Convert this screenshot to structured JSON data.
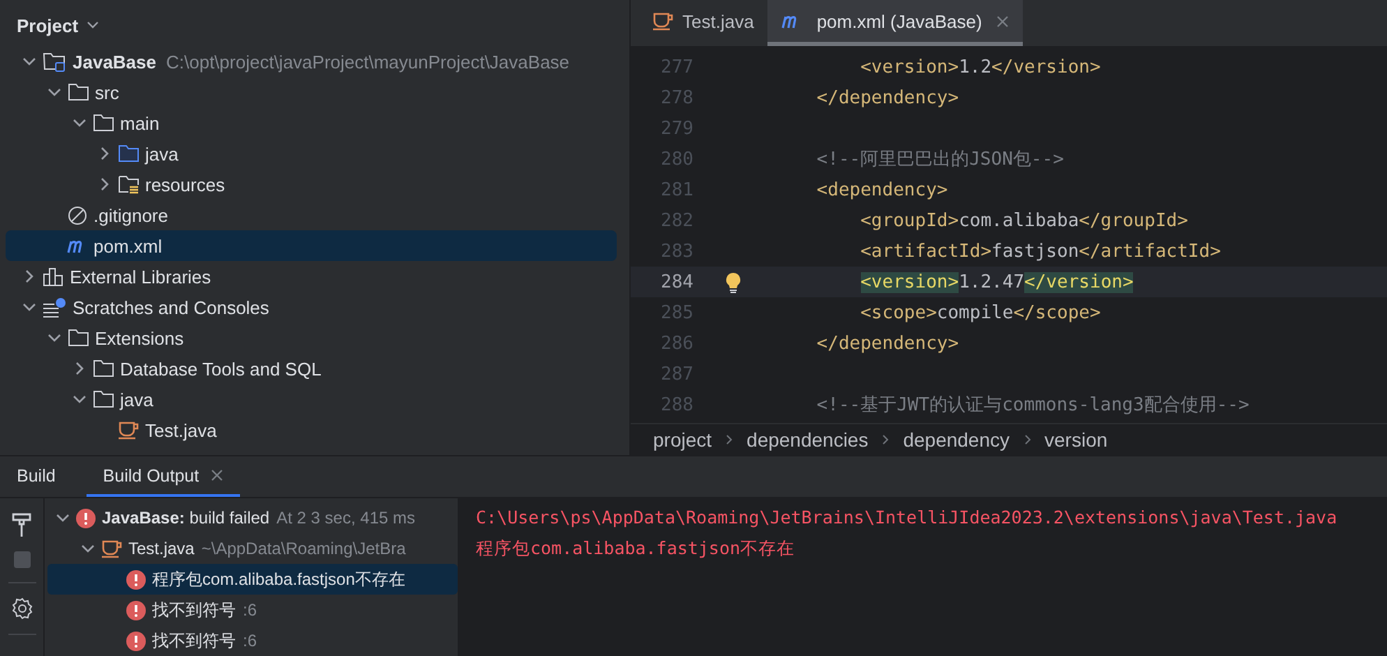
{
  "project_panel": {
    "title": "Project",
    "tree": [
      {
        "label": "JavaBase",
        "hint": "C:\\opt\\project\\javaProject\\mayunProject\\JavaBase",
        "kind": "module",
        "expanded": true,
        "selected": false,
        "bold": true,
        "children": [
          {
            "label": "src",
            "kind": "folder",
            "expanded": true,
            "selected": false,
            "bold": false,
            "children": [
              {
                "label": "main",
                "kind": "folder",
                "expanded": true,
                "selected": false,
                "bold": false,
                "children": [
                  {
                    "label": "java",
                    "kind": "sources",
                    "expanded": false,
                    "selected": false,
                    "bold": false
                  },
                  {
                    "label": "resources",
                    "kind": "resources",
                    "expanded": false,
                    "selected": false,
                    "bold": false
                  }
                ]
              }
            ]
          },
          {
            "label": ".gitignore",
            "kind": "ignore",
            "selected": false,
            "bold": false
          },
          {
            "label": "pom.xml",
            "kind": "maven",
            "selected": true,
            "bold": false
          }
        ]
      },
      {
        "label": "External Libraries",
        "kind": "libraries",
        "expanded": false,
        "selected": false,
        "bold": false
      },
      {
        "label": "Scratches and Consoles",
        "kind": "scratches",
        "expanded": true,
        "selected": false,
        "bold": false,
        "children": [
          {
            "label": "Extensions",
            "kind": "folder",
            "expanded": true,
            "selected": false,
            "bold": false,
            "children": [
              {
                "label": "Database Tools and SQL",
                "kind": "folder",
                "expanded": false,
                "selected": false,
                "bold": false
              },
              {
                "label": "java",
                "kind": "folder",
                "expanded": true,
                "selected": false,
                "bold": false,
                "children": [
                  {
                    "label": "Test.java",
                    "kind": "java",
                    "selected": false,
                    "bold": false
                  }
                ]
              }
            ]
          }
        ]
      }
    ]
  },
  "editor": {
    "tabs": [
      {
        "label": "Test.java",
        "kind": "java",
        "selected": false,
        "closable": false
      },
      {
        "label": "pom.xml (JavaBase)",
        "kind": "maven",
        "selected": true,
        "closable": true
      }
    ],
    "lines": [
      {
        "number": "277",
        "current": false,
        "bulb": false,
        "parts": [
          {
            "kind": "tag",
            "text": "        <version>",
            "matched": false
          },
          {
            "kind": "text",
            "text": "1.2",
            "matched": false
          },
          {
            "kind": "tag",
            "text": "</version>",
            "matched": false
          }
        ]
      },
      {
        "number": "278",
        "current": false,
        "bulb": false,
        "parts": [
          {
            "kind": "tag",
            "text": "    </dependency>",
            "matched": false
          }
        ]
      },
      {
        "number": "279",
        "current": false,
        "bulb": false
      },
      {
        "number": "280",
        "current": false,
        "bulb": false,
        "parts": [
          {
            "kind": "comment",
            "text": "    <!--阿里巴巴出的JSON包-->",
            "matched": false
          }
        ]
      },
      {
        "number": "281",
        "current": false,
        "bulb": false,
        "parts": [
          {
            "kind": "tag",
            "text": "    <dependency>",
            "matched": false
          }
        ]
      },
      {
        "number": "282",
        "current": false,
        "bulb": false,
        "parts": [
          {
            "kind": "tag",
            "text": "        <groupId>",
            "matched": false
          },
          {
            "kind": "text",
            "text": "com.alibaba",
            "matched": false
          },
          {
            "kind": "tag",
            "text": "</groupId>",
            "matched": false
          }
        ]
      },
      {
        "number": "283",
        "current": false,
        "bulb": false,
        "parts": [
          {
            "kind": "tag",
            "text": "        <artifactId>",
            "matched": false
          },
          {
            "kind": "text",
            "text": "fastjson",
            "matched": false
          },
          {
            "kind": "tag",
            "text": "</artifactId>",
            "matched": false
          }
        ]
      },
      {
        "number": "284",
        "current": true,
        "bulb": true,
        "parts": [
          {
            "kind": "tag",
            "text": "        <version>",
            "matched": true
          },
          {
            "kind": "text",
            "text": "1.2.47",
            "matched": false
          },
          {
            "kind": "tag",
            "text": "</version>",
            "matched": true
          }
        ]
      },
      {
        "number": "285",
        "current": false,
        "bulb": false,
        "parts": [
          {
            "kind": "tag",
            "text": "        <scope>",
            "matched": false
          },
          {
            "kind": "text",
            "text": "compile",
            "matched": false
          },
          {
            "kind": "tag",
            "text": "</scope>",
            "matched": false
          }
        ]
      },
      {
        "number": "286",
        "current": false,
        "bulb": false,
        "parts": [
          {
            "kind": "tag",
            "text": "    </dependency>",
            "matched": false
          }
        ]
      },
      {
        "number": "287",
        "current": false,
        "bulb": false
      },
      {
        "number": "288",
        "current": false,
        "bulb": false,
        "parts": [
          {
            "kind": "comment",
            "text": "    <!--基于JWT的认证与commons-lang3配合使用-->",
            "matched": false
          }
        ]
      }
    ],
    "breadcrumbs": [
      "project",
      "dependencies",
      "dependency",
      "version"
    ]
  },
  "build_panel": {
    "tabs": [
      {
        "label": "Build",
        "selected": false,
        "closable": false
      },
      {
        "label": "Build Output",
        "selected": true,
        "closable": true
      }
    ],
    "tree": [
      {
        "label": "**JavaBase:** build failed",
        "hint": "At 2 3 sec, 415 ms",
        "kind": "error",
        "expanded": true,
        "selected": false,
        "children": [
          {
            "label": "Test.java",
            "hint": "~\\AppData\\Roaming\\JetBra",
            "kind": "java",
            "expanded": true,
            "selected": false,
            "children": [
              {
                "label": "程序包com.alibaba.fastjson不存在",
                "kind": "error",
                "selected": true
              },
              {
                "label": "找不到符号",
                "hint": ":6",
                "kind": "error",
                "selected": false
              },
              {
                "label": "找不到符号",
                "hint": ":6",
                "kind": "error",
                "selected": false
              }
            ]
          }
        ]
      }
    ],
    "console": [
      "C:\\Users\\ps\\AppData\\Roaming\\JetBrains\\IntelliJIdea2023.2\\extensions\\java\\Test.java",
      "程序包com.alibaba.fastjson不存在"
    ]
  }
}
